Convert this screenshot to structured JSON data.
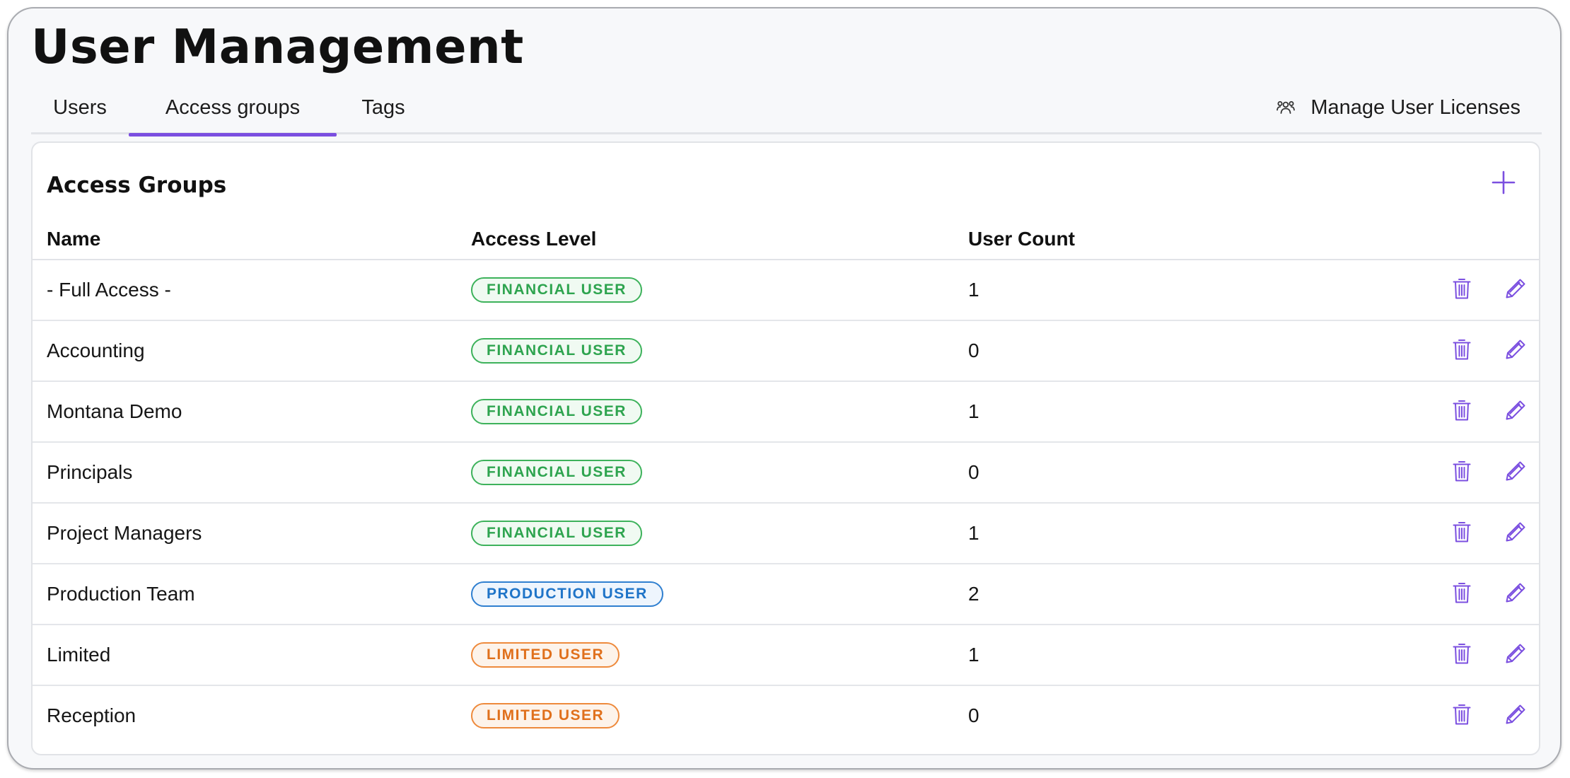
{
  "page": {
    "title": "User Management"
  },
  "tabs": [
    {
      "label": "Users",
      "active": false
    },
    {
      "label": "Access groups",
      "active": true
    },
    {
      "label": "Tags",
      "active": false
    }
  ],
  "licenses": {
    "label": "Manage User Licenses",
    "icon": "users-icon"
  },
  "card": {
    "title": "Access Groups",
    "add_icon": "plus-icon"
  },
  "table": {
    "headers": {
      "name": "Name",
      "access_level": "Access Level",
      "user_count": "User Count"
    },
    "rows": [
      {
        "name": "- Full Access -",
        "access_level": "FINANCIAL USER",
        "level_type": "financial",
        "user_count": "1"
      },
      {
        "name": "Accounting",
        "access_level": "FINANCIAL USER",
        "level_type": "financial",
        "user_count": "0"
      },
      {
        "name": "Montana Demo",
        "access_level": "FINANCIAL USER",
        "level_type": "financial",
        "user_count": "1"
      },
      {
        "name": "Principals",
        "access_level": "FINANCIAL USER",
        "level_type": "financial",
        "user_count": "0"
      },
      {
        "name": "Project Managers",
        "access_level": "FINANCIAL USER",
        "level_type": "financial",
        "user_count": "1"
      },
      {
        "name": "Production Team",
        "access_level": "PRODUCTION USER",
        "level_type": "production",
        "user_count": "2"
      },
      {
        "name": "Limited",
        "access_level": "LIMITED USER",
        "level_type": "limited",
        "user_count": "1"
      },
      {
        "name": "Reception",
        "access_level": "LIMITED USER",
        "level_type": "limited",
        "user_count": "0"
      }
    ],
    "row_actions": [
      "trash-icon",
      "pencil-icon"
    ]
  },
  "colors": {
    "accent": "#7b4fe0",
    "financial": "#2ea44f",
    "production": "#1f74c8",
    "limited": "#e0701c"
  }
}
